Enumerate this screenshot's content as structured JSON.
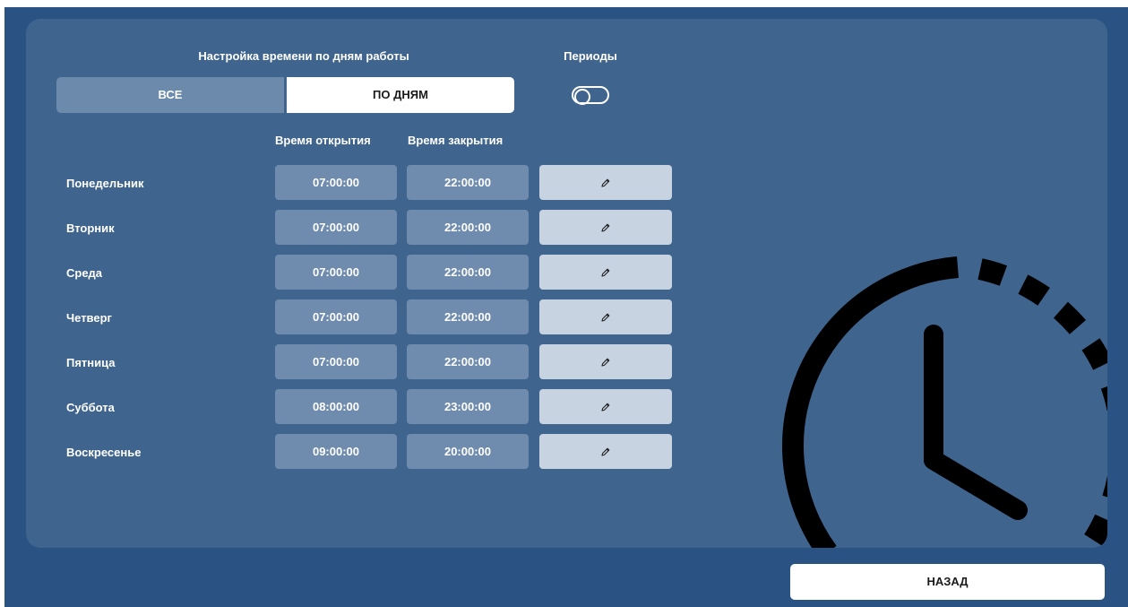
{
  "header": {
    "work_days_title": "Настройка времени по дням работы",
    "periods_title": "Периоды"
  },
  "mode": {
    "all_label": "ВСЕ",
    "by_days_label": "ПО ДНЯМ",
    "selected": "ПО ДНЯМ"
  },
  "periods_toggle": {
    "on": false
  },
  "columns": {
    "open": "Время открытия",
    "close": "Время закрытия"
  },
  "days": [
    {
      "name": "Понедельник",
      "open": "07:00:00",
      "close": "22:00:00"
    },
    {
      "name": "Вторник",
      "open": "07:00:00",
      "close": "22:00:00"
    },
    {
      "name": "Среда",
      "open": "07:00:00",
      "close": "22:00:00"
    },
    {
      "name": "Четверг",
      "open": "07:00:00",
      "close": "22:00:00"
    },
    {
      "name": "Пятница",
      "open": "07:00:00",
      "close": "22:00:00"
    },
    {
      "name": "Суббота",
      "open": "08:00:00",
      "close": "23:00:00"
    },
    {
      "name": "Воскресенье",
      "open": "09:00:00",
      "close": "20:00:00"
    }
  ],
  "icons": {
    "edit": "pencil-icon",
    "decoration": "clock-icon"
  },
  "footer": {
    "back_label": "НАЗАД"
  },
  "colors": {
    "background": "#2a5383",
    "panel": "#3f648e",
    "time_box": "#6f8cae",
    "edit_button": "#c7d3e1"
  }
}
